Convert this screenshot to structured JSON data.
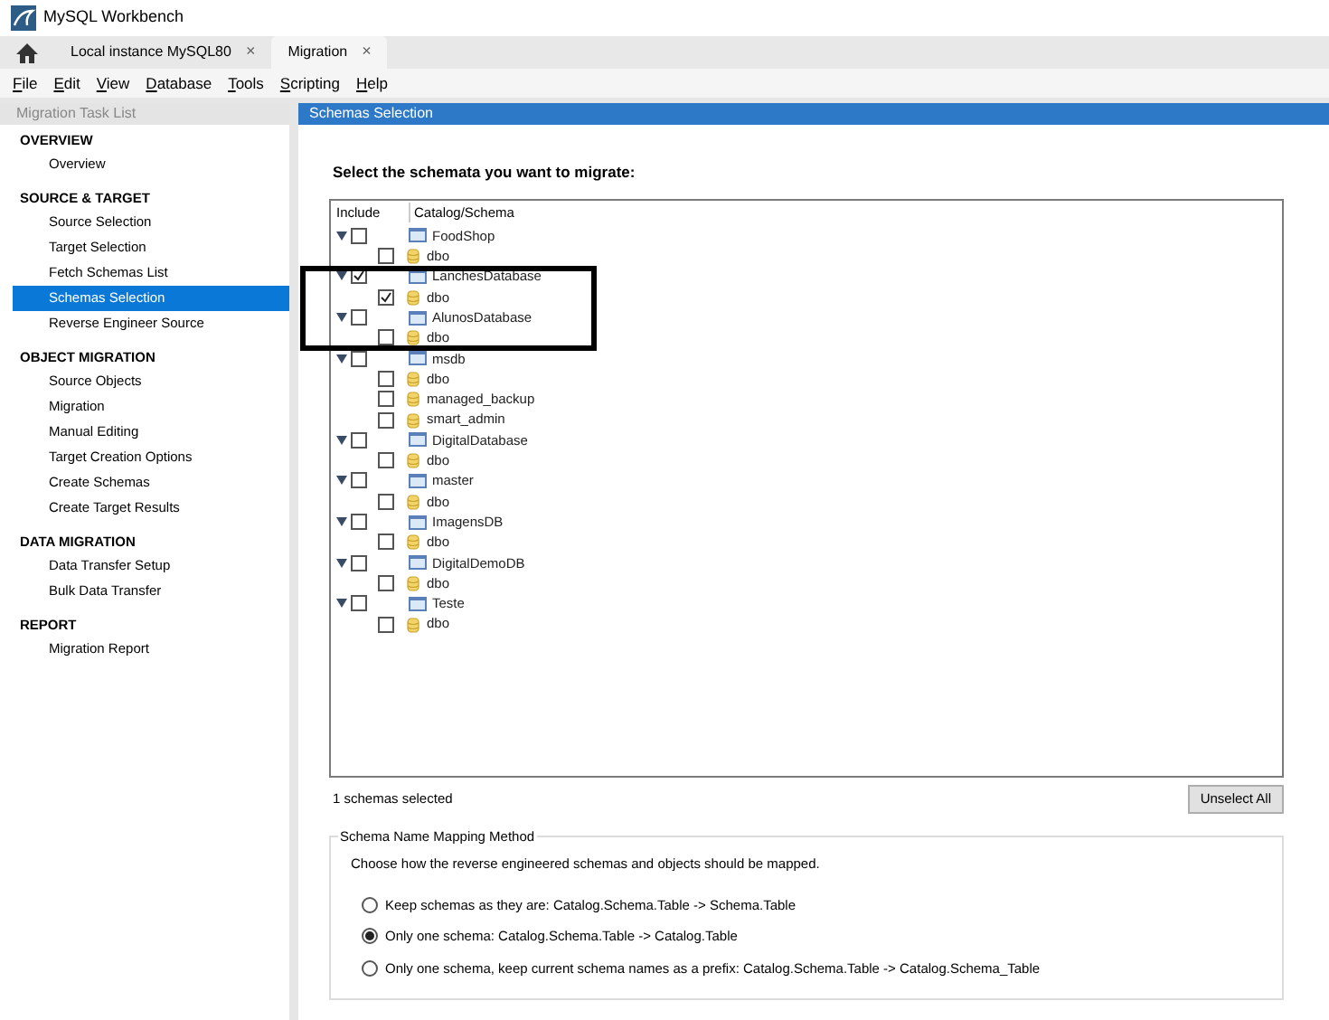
{
  "window": {
    "title": "MySQL Workbench"
  },
  "tabs": [
    {
      "kind": "home",
      "selected": false
    },
    {
      "kind": "doc",
      "label": "Local instance MySQL80",
      "close": "×",
      "selected": false
    },
    {
      "kind": "doc",
      "label": "Migration",
      "close": "×",
      "selected": true
    }
  ],
  "menu": [
    "File",
    "Edit",
    "View",
    "Database",
    "Tools",
    "Scripting",
    "Help"
  ],
  "sidebar": {
    "title": "Migration Task List",
    "sections": [
      {
        "heading": "OVERVIEW",
        "items": [
          {
            "label": "Overview",
            "selected": false
          }
        ]
      },
      {
        "heading": "SOURCE & TARGET",
        "items": [
          {
            "label": "Source Selection",
            "selected": false
          },
          {
            "label": "Target Selection",
            "selected": false
          },
          {
            "label": "Fetch Schemas List",
            "selected": false
          },
          {
            "label": "Schemas Selection",
            "selected": true
          },
          {
            "label": "Reverse Engineer Source",
            "selected": false
          }
        ]
      },
      {
        "heading": "OBJECT MIGRATION",
        "items": [
          {
            "label": "Source Objects",
            "selected": false
          },
          {
            "label": "Migration",
            "selected": false
          },
          {
            "label": "Manual Editing",
            "selected": false
          },
          {
            "label": "Target Creation Options",
            "selected": false
          },
          {
            "label": "Create Schemas",
            "selected": false
          },
          {
            "label": "Create Target Results",
            "selected": false
          }
        ]
      },
      {
        "heading": "DATA MIGRATION",
        "items": [
          {
            "label": "Data Transfer Setup",
            "selected": false
          },
          {
            "label": "Bulk Data Transfer",
            "selected": false
          }
        ]
      },
      {
        "heading": "REPORT",
        "items": [
          {
            "label": "Migration Report",
            "selected": false
          }
        ]
      }
    ]
  },
  "page": {
    "title": "Schemas Selection",
    "prompt": "Select the schemata you want to migrate:",
    "tree": {
      "columns": [
        "Include",
        "Catalog/Schema"
      ],
      "catalogs": [
        {
          "name": "FoodShop",
          "expanded": true,
          "checked": false,
          "children": [
            {
              "name": "dbo",
              "checked": false
            }
          ]
        },
        {
          "name": "LanchesDatabase",
          "expanded": true,
          "checked": true,
          "children": [
            {
              "name": "dbo",
              "checked": true
            }
          ]
        },
        {
          "name": "AlunosDatabase",
          "expanded": true,
          "checked": false,
          "children": [
            {
              "name": "dbo",
              "checked": false
            }
          ]
        },
        {
          "name": "msdb",
          "expanded": true,
          "checked": false,
          "children": [
            {
              "name": "dbo",
              "checked": false
            },
            {
              "name": "managed_backup",
              "checked": false
            },
            {
              "name": "smart_admin",
              "checked": false
            }
          ]
        },
        {
          "name": "DigitalDatabase",
          "expanded": true,
          "checked": false,
          "children": [
            {
              "name": "dbo",
              "checked": false
            }
          ]
        },
        {
          "name": "master",
          "expanded": true,
          "checked": false,
          "children": [
            {
              "name": "dbo",
              "checked": false
            }
          ]
        },
        {
          "name": "ImagensDB",
          "expanded": true,
          "checked": false,
          "children": [
            {
              "name": "dbo",
              "checked": false
            }
          ]
        },
        {
          "name": "DigitalDemoDB",
          "expanded": true,
          "checked": false,
          "children": [
            {
              "name": "dbo",
              "checked": false
            }
          ]
        },
        {
          "name": "Teste",
          "expanded": true,
          "checked": false,
          "children": [
            {
              "name": "dbo",
              "checked": false
            }
          ]
        }
      ]
    },
    "count": "1 schemas selected",
    "unselect_button": "Unselect All",
    "mapping": {
      "title": "Schema Name Mapping Method",
      "description": "Choose how the reverse engineered schemas and objects should be mapped.",
      "options": [
        {
          "label": "Keep schemas as they are: Catalog.Schema.Table -> Schema.Table",
          "selected": false
        },
        {
          "label": "Only one schema: Catalog.Schema.Table -> Catalog.Table",
          "selected": true
        },
        {
          "label": "Only one schema, keep current schema names as a prefix: Catalog.Schema.Table -> Catalog.Schema_Table",
          "selected": false
        }
      ]
    }
  }
}
